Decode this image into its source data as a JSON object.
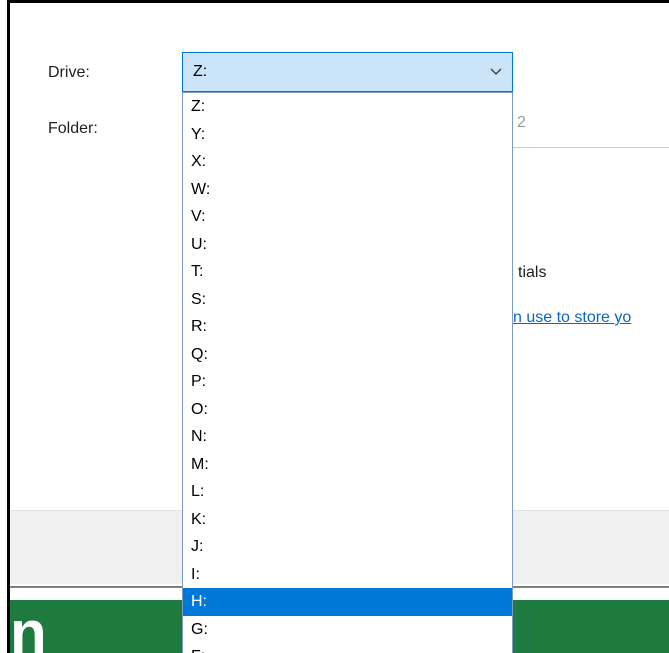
{
  "dialog": {
    "drive_label": "Drive:",
    "folder_label": "Folder:",
    "folder_value_partial": "2",
    "credentials_partial": "tials",
    "link_partial": "n use to store yo"
  },
  "drive_combo": {
    "selected": "Z:",
    "options": [
      "Z:",
      "Y:",
      "X:",
      "W:",
      "V:",
      "U:",
      "T:",
      "S:",
      "R:",
      "Q:",
      "P:",
      "O:",
      "N:",
      "M:",
      "L:",
      "K:",
      "J:",
      "I:",
      "H:",
      "G:",
      "F:"
    ],
    "highlighted": "H:"
  },
  "background": {
    "logo_partial": "n"
  },
  "colors": {
    "accent": "#0078d7",
    "combo_bg": "#cce4f7",
    "link": "#0b66c2",
    "brand_green": "#1f7a3f"
  }
}
